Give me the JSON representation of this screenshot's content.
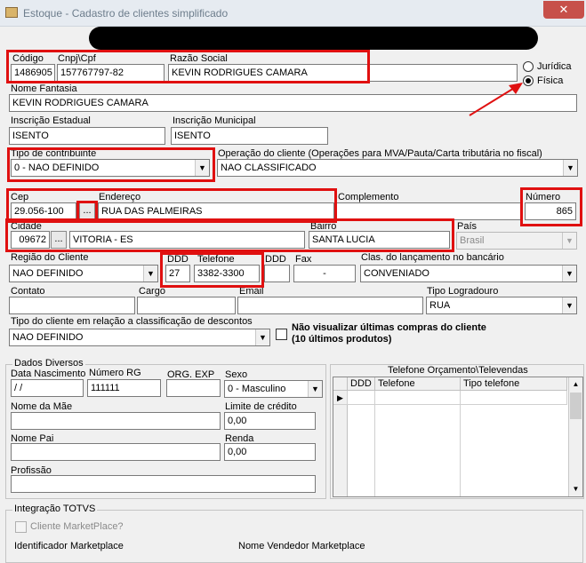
{
  "window": {
    "title": "Estoque - Cadastro de clientes simplificado",
    "close": "✕"
  },
  "cliente": {
    "codigo_label": "Código",
    "codigo": "1486905",
    "cnpj_label": "Cnpj\\Cpf",
    "cnpj": "157767797-82",
    "razao_label": "Razão Social",
    "razao": "KEVIN RODRIGUES CAMARA",
    "pessoa_juridica": "Jurídica",
    "pessoa_fisica": "Física",
    "pessoa_selected": "Física",
    "fantasia_label": "Nome Fantasia",
    "fantasia": "KEVIN RODRIGUES CAMARA",
    "ie_label": "Inscrição Estadual",
    "ie": "ISENTO",
    "im_label": "Inscrição Municipal",
    "im": "ISENTO",
    "tipo_contrib_label": "Tipo de contribuinte",
    "tipo_contrib": "0 - NAO DEFINIDO",
    "operacao_label": "Operação do cliente (Operações para MVA/Pauta/Carta tributária no fiscal)",
    "operacao": "NAO CLASSIFICADO"
  },
  "endereco": {
    "cep_label": "Cep",
    "cep": "29.056-100",
    "cep_btn": "...",
    "endereco_label": "Endereço",
    "endereco": "RUA DAS PALMEIRAS",
    "complemento_label": "Complemento",
    "complemento": "",
    "numero_label": "Número",
    "numero": "865",
    "cidade_label": "Cidade",
    "cidade_cod": "09672",
    "cidade_btn": "...",
    "cidade": "VITORIA - ES",
    "bairro_label": "Bairro",
    "bairro": "SANTA LUCIA",
    "pais_label": "País",
    "pais": "Brasil",
    "regiao_label": "Região do Cliente",
    "regiao": "NAO DEFINIDO",
    "ddd_label": "DDD",
    "ddd": "27",
    "telefone_label": "Telefone",
    "telefone": "3382-3300",
    "ddd2_label": "DDD",
    "ddd2": "",
    "fax_label": "Fax",
    "fax": "-",
    "clas_label": "Clas. do lançamento no bancário",
    "clas": "CONVENIADO",
    "contato_label": "Contato",
    "contato": "",
    "cargo_label": "Cargo",
    "cargo": "",
    "email_label": "Email",
    "email": "",
    "logradouro_label": "Tipo Logradouro",
    "logradouro": "RUA",
    "tipo_desc_label": "Tipo do cliente em relação a classificação de descontos",
    "tipo_desc": "NAO DEFINIDO",
    "nao_visualizar": "Não visualizar últimas compras do cliente",
    "nao_visualizar_2": "(10 últimos produtos)"
  },
  "dados": {
    "group_title": "Dados Diversos",
    "nasc_label": "Data Nascimento",
    "nasc": " /  /",
    "rg_label": "Número RG",
    "rg": "111111",
    "org_label": "ORG. EXP",
    "org": "",
    "sexo_label": "Sexo",
    "sexo": "0 - Masculino",
    "mae_label": "Nome da Mãe",
    "mae": "",
    "limite_label": "Limite de crédito",
    "limite": "0,00",
    "pai_label": "Nome Pai",
    "pai": "",
    "renda_label": "Renda",
    "renda": "0,00",
    "profissao_label": "Profissão",
    "profissao": ""
  },
  "telefones": {
    "title": "Telefone Orçamento\\Televendas",
    "columns": [
      "DDD",
      "Telefone",
      "Tipo telefone"
    ]
  },
  "totvs": {
    "group_title": "Integração TOTVS",
    "marketplace": "Cliente MarketPlace?",
    "identificador_label": "Identificador Marketplace",
    "vendedor_label": "Nome Vendedor Marketplace"
  },
  "colors": {
    "highlight": "#e01010",
    "titlebar": "#e6ebf1",
    "close": "#c7504a"
  }
}
